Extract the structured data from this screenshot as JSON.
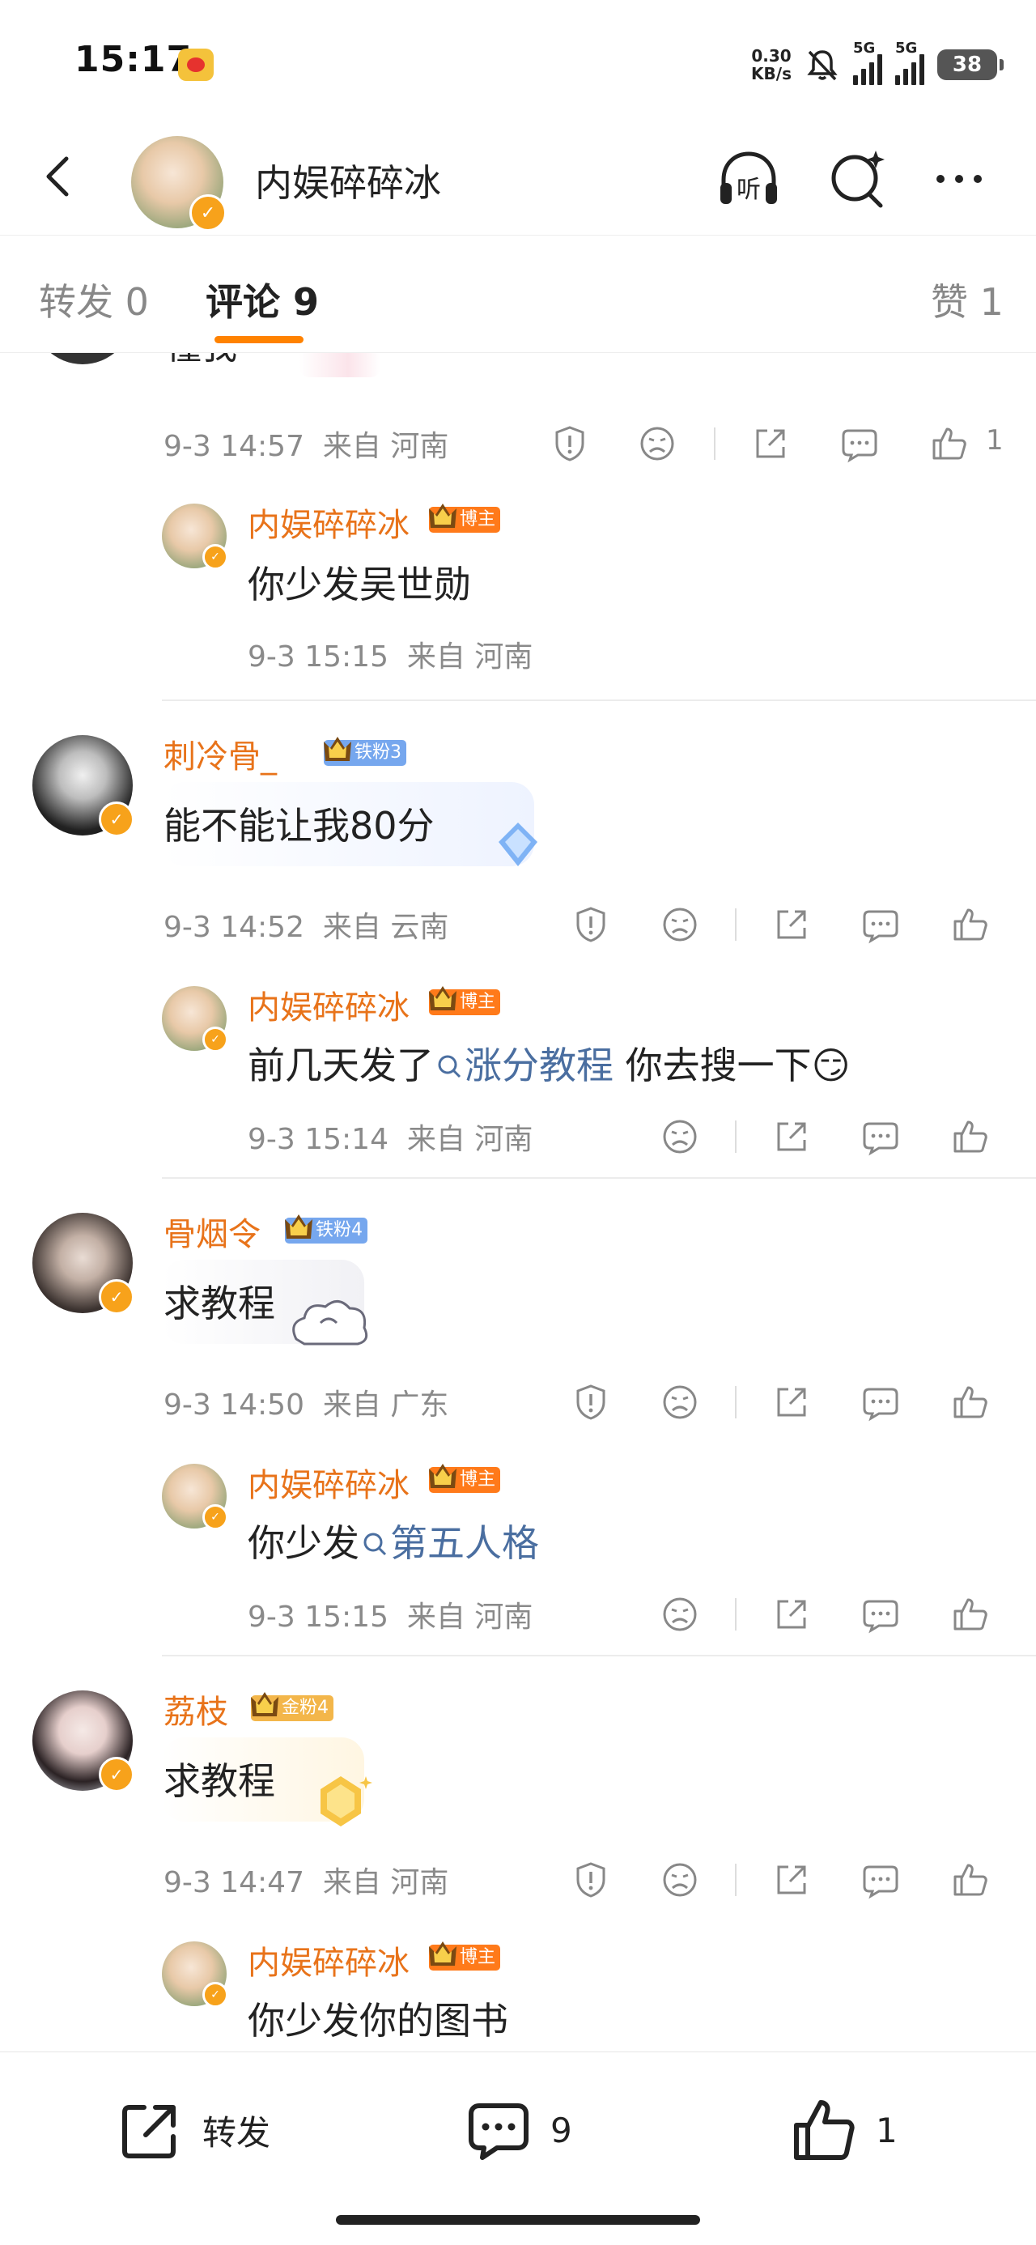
{
  "status_bar": {
    "time": "15:17",
    "net_speed_value": "0.30",
    "net_speed_unit": "KB/s",
    "network1": "5G",
    "network2": "5G",
    "battery": "38"
  },
  "header": {
    "title": "内娱碎碎冰",
    "listen_label": "听"
  },
  "tabs": {
    "repost": "转发 0",
    "comments": "评论 9",
    "likes": "赞 1"
  },
  "truncated_comment": {
    "text_fragment": "懂我",
    "time": "9-3 14:57",
    "location": "来自 河南",
    "like_count": "1",
    "reply": {
      "user": "内娱碎碎冰",
      "badge": "博主",
      "text": "你少发吴世勋",
      "time": "9-3 15:15",
      "location": "来自 河南"
    }
  },
  "comments": [
    {
      "user": "刺冷骨_",
      "badge": "铁粉3",
      "text": "能不能让我80分",
      "time": "9-3 14:52",
      "location": "来自 云南",
      "reply": {
        "user": "内娱碎碎冰",
        "badge": "博主",
        "text_before": "前几天发了",
        "topic": "涨分教程",
        "text_after": " 你去搜一下😏",
        "time": "9-3 15:14",
        "location": "来自 河南"
      }
    },
    {
      "user": "骨烟令",
      "badge": "铁粉4",
      "text": "求教程",
      "time": "9-3 14:50",
      "location": "来自 广东",
      "reply": {
        "user": "内娱碎碎冰",
        "badge": "博主",
        "text_before": "你少发",
        "topic": "第五人格",
        "time": "9-3 15:15",
        "location": "来自 河南"
      }
    },
    {
      "user": "荔枝",
      "badge": "金粉4",
      "text": "求教程",
      "time": "9-3 14:47",
      "location": "来自 河南",
      "reply": {
        "user": "内娱碎碎冰",
        "badge": "博主",
        "text": "你少发你的图书"
      }
    }
  ],
  "bottom_bar": {
    "repost_label": "转发",
    "comment_count": "9",
    "like_count": "1"
  },
  "colors": {
    "accent_orange": "#ff8200",
    "username_orange": "#e8731a",
    "topic_blue": "#4a6ea0",
    "meta_gray": "#8a8a8a",
    "blogger_badge": "#ff7a1a",
    "iron_fan_badge": "#76a7ee",
    "gold_fan_badge": "#f3b64a"
  },
  "icons": [
    "back-icon",
    "headphones-icon",
    "search-sparkle-icon",
    "more-icon",
    "report-icon",
    "dislike-icon",
    "share-icon",
    "comment-icon",
    "like-icon",
    "repost-icon",
    "verified-icon",
    "crown-icon"
  ]
}
